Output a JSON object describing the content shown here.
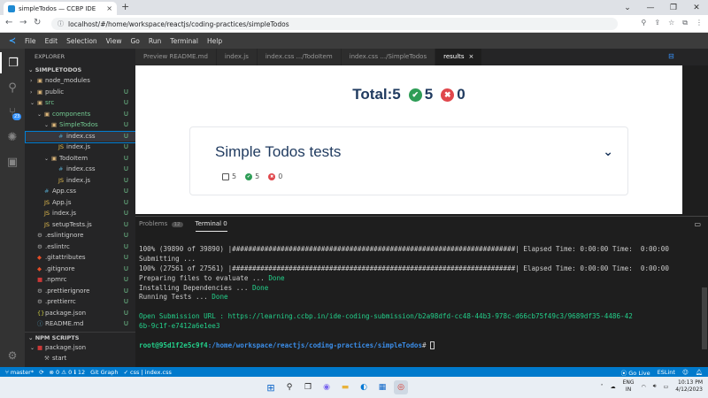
{
  "browser": {
    "tab_title": "simpleTodos — CCBP IDE",
    "tab_close": "×",
    "new_tab": "+",
    "url": "localhost/#/home/workspace/reactjs/coding-practices/simpleTodos"
  },
  "menu": [
    "File",
    "Edit",
    "Selection",
    "View",
    "Go",
    "Run",
    "Terminal",
    "Help"
  ],
  "activity": {
    "scm_badge": "23"
  },
  "sidebar": {
    "title": "EXPLORER",
    "project": "SIMPLETODOS",
    "items": [
      {
        "label": "node_modules",
        "type": "folder",
        "indent": 0,
        "chev": "›",
        "status": ""
      },
      {
        "label": "public",
        "type": "folder",
        "indent": 0,
        "chev": "›",
        "status": "U"
      },
      {
        "label": "src",
        "type": "folder",
        "indent": 0,
        "chev": "⌄",
        "status": "U",
        "mod": true
      },
      {
        "label": "components",
        "type": "folder",
        "indent": 1,
        "chev": "⌄",
        "status": "U",
        "mod": true
      },
      {
        "label": "SimpleTodos",
        "type": "folder",
        "indent": 2,
        "chev": "⌄",
        "status": "U",
        "mod": true
      },
      {
        "label": "index.css",
        "type": "css",
        "indent": 3,
        "chev": "",
        "status": "U",
        "sel": true
      },
      {
        "label": "index.js",
        "type": "js",
        "indent": 3,
        "chev": "",
        "status": "U"
      },
      {
        "label": "TodoItem",
        "type": "folder",
        "indent": 2,
        "chev": "⌄",
        "status": "U"
      },
      {
        "label": "index.css",
        "type": "css",
        "indent": 3,
        "chev": "",
        "status": "U"
      },
      {
        "label": "index.js",
        "type": "js",
        "indent": 3,
        "chev": "",
        "status": "U"
      },
      {
        "label": "App.css",
        "type": "css",
        "indent": 1,
        "chev": "",
        "status": "U"
      },
      {
        "label": "App.js",
        "type": "js",
        "indent": 1,
        "chev": "",
        "status": "U"
      },
      {
        "label": "index.js",
        "type": "js",
        "indent": 1,
        "chev": "",
        "status": "U"
      },
      {
        "label": "setupTests.js",
        "type": "js",
        "indent": 1,
        "chev": "",
        "status": "U"
      },
      {
        "label": ".eslintignore",
        "type": "gear",
        "indent": 0,
        "chev": "",
        "status": "U"
      },
      {
        "label": ".eslintrc",
        "type": "gear",
        "indent": 0,
        "chev": "",
        "status": "U"
      },
      {
        "label": ".gitattributes",
        "type": "git",
        "indent": 0,
        "chev": "",
        "status": "U"
      },
      {
        "label": ".gitignore",
        "type": "git",
        "indent": 0,
        "chev": "",
        "status": "U"
      },
      {
        "label": ".npmrc",
        "type": "npm",
        "indent": 0,
        "chev": "",
        "status": "U"
      },
      {
        "label": ".prettierignore",
        "type": "gear",
        "indent": 0,
        "chev": "",
        "status": "U"
      },
      {
        "label": ".prettierrc",
        "type": "gear",
        "indent": 0,
        "chev": "",
        "status": "U"
      },
      {
        "label": "package.json",
        "type": "json",
        "indent": 0,
        "chev": "",
        "status": "U"
      },
      {
        "label": "README.md",
        "type": "md",
        "indent": 0,
        "chev": "",
        "status": "U"
      }
    ],
    "npm_title": "NPM SCRIPTS",
    "npm_items": [
      {
        "label": "package.json",
        "type": "npm",
        "indent": 0,
        "chev": "⌄"
      },
      {
        "label": "start",
        "type": "script",
        "indent": 1,
        "chev": ""
      }
    ]
  },
  "editor_tabs": [
    {
      "label": "Preview README.md",
      "active": false
    },
    {
      "label": "index.js",
      "active": false
    },
    {
      "label": "index.css .../TodoItem",
      "active": false
    },
    {
      "label": "index.css .../SimpleTodos",
      "active": false
    },
    {
      "label": "results",
      "active": true
    }
  ],
  "results": {
    "total_label": "Total:5",
    "passed": "5",
    "failed": "0",
    "suite_title": "Simple Todos tests",
    "mini_total": "5",
    "mini_passed": "5",
    "mini_failed": "0"
  },
  "panel": {
    "tab_problems": "Problems",
    "problems_count": "12",
    "tab_terminal": "Terminal 0",
    "lines": [
      "100% (39890 of 39890) |######################################################################| Elapsed Time: 0:00:00 Time:  0:00:00",
      "Submitting ...",
      "100% (27561 of 27561) |######################################################################| Elapsed Time: 0:00:00 Time:  0:00:00"
    ],
    "steps": [
      {
        "text": "Preparing files to evaluate ... ",
        "done": "Done"
      },
      {
        "text": "Installing Dependencies ... ",
        "done": "Done"
      },
      {
        "text": "Running Tests ... ",
        "done": "Done"
      }
    ],
    "submission_1": "Open Submission URL : https://learning.ccbp.in/ide-coding-submission/b2a98dfd-cc48-44b3-978c-d66cb75f49c3/9689df35-4486-42",
    "submission_2": "6b-9c1f-e7412a6e1ee3",
    "prompt_user": "root@95d1f2e5c9f4",
    "prompt_path": ":/home/workspace/reactjs/coding-practices/simpleTodos",
    "prompt_end": "# "
  },
  "status": {
    "branch": "master*",
    "problems": "⊗ 0 ⚠ 0 ℹ 12",
    "git_graph": "Git Graph",
    "breadcrumb": "css | index.css",
    "golive": "Go Live",
    "eslint": "ESLint"
  },
  "taskbar": {
    "lang_top": "ENG",
    "lang_bottom": "IN",
    "time": "10:13 PM",
    "date": "4/12/2023"
  },
  "colors": {
    "accent": "#007acc",
    "pass": "#2e9d56",
    "fail": "#e0474c",
    "heading": "#1f3a5f"
  }
}
